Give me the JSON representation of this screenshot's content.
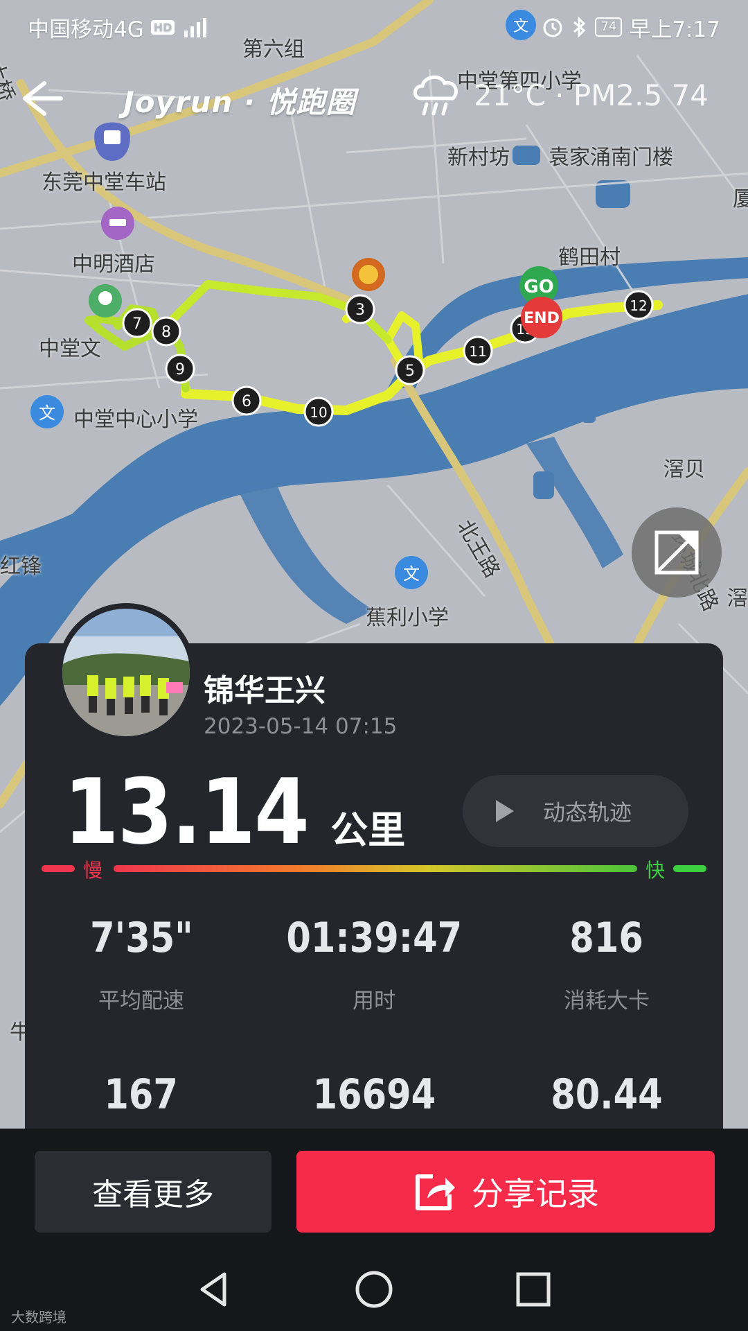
{
  "status_bar": {
    "carrier": "中国移动4G",
    "hd": "HD",
    "battery": "74",
    "time": "早上7:17"
  },
  "header": {
    "logo": "Joyrun · 悦跑圈",
    "temperature": "21°C · PM2.5 74",
    "back_icon": "arrow-left-icon",
    "weather_icon": "rain-cloud-icon"
  },
  "map": {
    "labels": [
      {
        "key": "l1",
        "text": "第六组"
      },
      {
        "key": "l2",
        "text": "中堂第四小学"
      },
      {
        "key": "l3",
        "text": "新村坊"
      },
      {
        "key": "l4",
        "text": "袁家涌南门楼"
      },
      {
        "key": "l5",
        "text": "东莞中堂车站"
      },
      {
        "key": "l6",
        "text": "中明酒店"
      },
      {
        "key": "l7",
        "text": "鹤田村"
      },
      {
        "key": "l8",
        "text": "中堂文"
      },
      {
        "key": "l9",
        "text": "中堂中心小学"
      },
      {
        "key": "l10",
        "text": "滘贝"
      },
      {
        "key": "l11",
        "text": "红锋"
      },
      {
        "key": "l12",
        "text": "蕉利小学"
      },
      {
        "key": "l13",
        "text": "北王路"
      },
      {
        "key": "l14",
        "text": "环城北路"
      },
      {
        "key": "l15",
        "text": "滘"
      },
      {
        "key": "l16",
        "text": "大桥"
      },
      {
        "key": "l17",
        "text": "牛"
      },
      {
        "key": "l18",
        "text": "厦"
      }
    ],
    "km_markers": [
      "3",
      "5",
      "6",
      "7",
      "8",
      "9",
      "10",
      "11",
      "12",
      "13"
    ],
    "start_label": "GO",
    "end_label": "END",
    "track_color": "#e6f12c",
    "river_color": "#4a7fb5"
  },
  "run": {
    "user_name": "锦华王兴",
    "date": "2023-05-14 07:15",
    "distance": "13.14",
    "distance_unit": "公里",
    "replay_label": "动态轨迹",
    "speed_slow": "慢",
    "speed_fast": "快",
    "stats": [
      {
        "value": "7'35\"",
        "label": "平均配速"
      },
      {
        "value": "01:39:47",
        "label": "用时"
      },
      {
        "value": "816",
        "label": "消耗大卡"
      },
      {
        "value": "167",
        "label": ""
      },
      {
        "value": "16694",
        "label": ""
      },
      {
        "value": "80.44",
        "label": ""
      }
    ]
  },
  "actions": {
    "more_label": "查看更多",
    "share_label": "分享记录"
  },
  "watermark": "大数跨境",
  "colors": {
    "accent": "#f62b4a",
    "card_bg": "#24262c"
  }
}
